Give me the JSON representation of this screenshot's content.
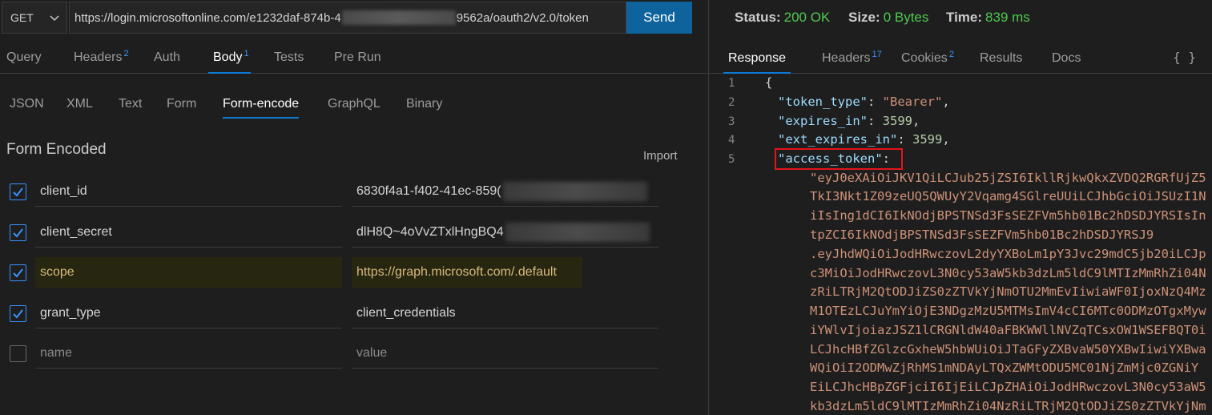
{
  "request": {
    "method": "GET",
    "url_prefix": "https://login.microsoftonline.com/e1232daf-874b-4",
    "url_suffix": "9562a/oauth2/v2.0/token",
    "send_label": "Send"
  },
  "request_tabs": [
    {
      "label": "Query",
      "badge": ""
    },
    {
      "label": "Headers",
      "badge": "2"
    },
    {
      "label": "Auth",
      "badge": ""
    },
    {
      "label": "Body",
      "badge": "1"
    },
    {
      "label": "Tests",
      "badge": ""
    },
    {
      "label": "Pre Run",
      "badge": ""
    }
  ],
  "body_tabs": [
    "JSON",
    "XML",
    "Text",
    "Form",
    "Form-encode",
    "GraphQL",
    "Binary"
  ],
  "form": {
    "title": "Form Encoded",
    "import_label": "Import",
    "rows": [
      {
        "checked": true,
        "key": "client_id",
        "value": "6830f4a1-f402-41ec-859("
      },
      {
        "checked": true,
        "key": "client_secret",
        "value": "dlH8Q~4oVvZTxlHngBQ4"
      },
      {
        "checked": true,
        "key": "scope",
        "value": "https://graph.microsoft.com/.default"
      },
      {
        "checked": true,
        "key": "grant_type",
        "value": "client_credentials"
      },
      {
        "checked": false,
        "key": "name",
        "value": "value"
      }
    ]
  },
  "response": {
    "status_label": "Status:",
    "status_value": "200 OK",
    "size_label": "Size:",
    "size_value": "0 Bytes",
    "time_label": "Time:",
    "time_value": "839 ms",
    "tabs": [
      {
        "label": "Response",
        "badge": ""
      },
      {
        "label": "Headers",
        "badge": "17"
      },
      {
        "label": "Cookies",
        "badge": "2"
      },
      {
        "label": "Results",
        "badge": ""
      },
      {
        "label": "Docs",
        "badge": ""
      }
    ],
    "braces_label": "{ }",
    "line_numbers": [
      "1",
      "2",
      "3",
      "4",
      "5"
    ],
    "lines": {
      "open": "{",
      "token_type_key": "\"token_type\"",
      "token_type_val": "\"Bearer\"",
      "expires_in_key": "\"expires_in\"",
      "expires_in_val": "3599",
      "ext_expires_in_key": "\"ext_expires_in\"",
      "ext_expires_in_val": "3599",
      "access_token_key": "\"access_token\""
    },
    "token_lines": [
      "\"eyJ0eXAiOiJKV1QiLCJub25jZSI6IkllRjkwQkxZVDQ2RGRfUjZ5",
      "TkI3Nkt1Z09zeUQ5QWUyY2Vqamg4SGlreUUiLCJhbGciOiJSUzI1N",
      "iIsIng1dCI6IkNOdjBPSTNSd3FsSEZFVm5hb01Bc2hDSDJYRSIsIn",
      "tpZCI6IkNOdjBPSTNSd3FsSEZFVm5hb01Bc2hDSDJYRSJ9",
      ".eyJhdWQiOiJodHRwczovL2dyYXBoLm1pY3Jvc29mdC5jb20iLCJp",
      "c3MiOiJodHRwczovL3N0cy53aW5kb3dzLm5ldC9lMTIzMmRhZi04N",
      "zRiLTRjM2QtODJiZS0zZTVkYjNmOTU2MmEvIiwiaWF0IjoxNzQ4Mz",
      "M1OTEzLCJuYmYiOjE3NDgzMzU5MTMsImV4cCI6MTc0ODMzOTgxMyw",
      "iYWlvIjoiazJSZ1lCRGNldW40aFBKWWllNVZqTCsxOW1WSEFBQT0i",
      "LCJhcHBfZGlzcGxheW5hbWUiOiJTaGFyZXBvaW50YXBwIiwiYXBwa",
      "WQiOiI2ODMwZjRhMS1mNDAyLTQxZWMtODU5MC01NjZmMjc0ZGNiY",
      "EiLCJhcHBpZGFjciI6IjEiLCJpZHAiOiJodHRwczovL3N0cy53aW5",
      "kb3dzLm5ldC9lMTIzMmRhZi04NzRiLTRjM2QtODJiZS0zZTVkYjNm"
    ]
  }
}
